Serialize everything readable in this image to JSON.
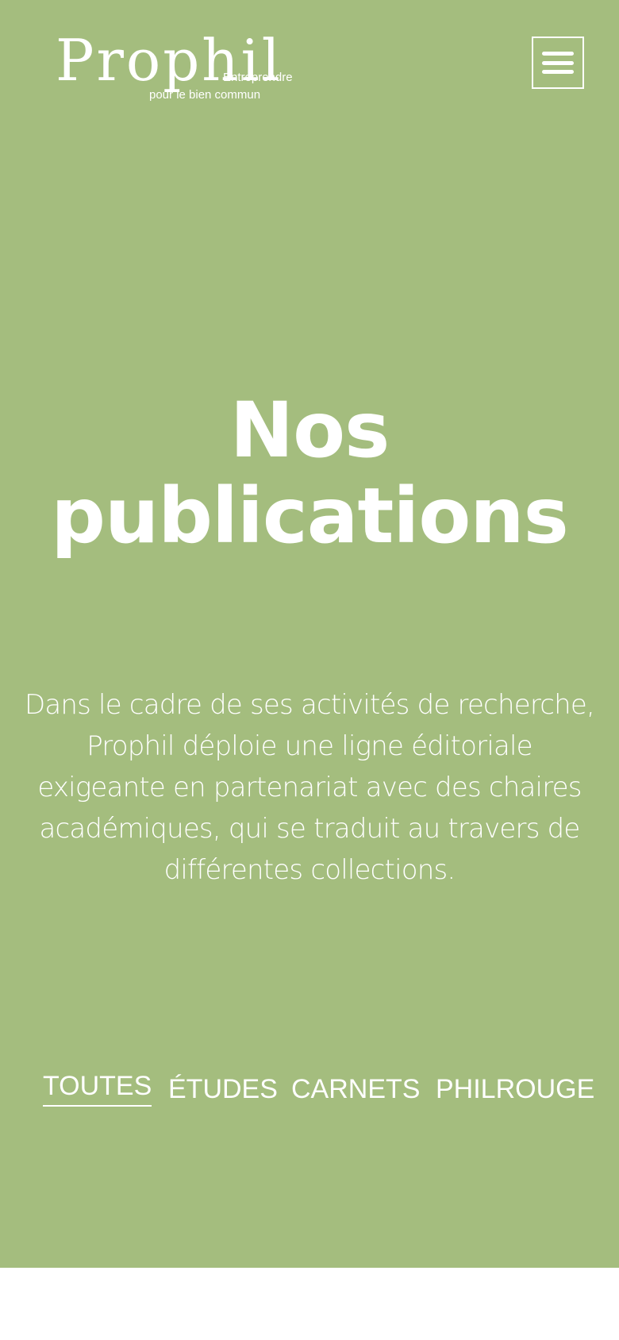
{
  "header": {
    "logo": {
      "word": "Prophil",
      "tagline_1": "Entreprendre",
      "tagline_2": "pour le bien commun"
    },
    "menu_icon": "hamburger-menu-icon"
  },
  "hero": {
    "background_color": "#a4bd7e",
    "title_line_1": "Nos",
    "title_line_2": "publications",
    "intro": "Dans le cadre de ses activités de recherche, Prophil déploie une ligne éditoriale exigeante en partenariat avec des chaires académiques, qui se traduit au travers de différentes collections."
  },
  "filters": {
    "active": "TOUTES",
    "tabs": [
      {
        "label": "TOUTES"
      },
      {
        "label": "ÉTUDES"
      },
      {
        "label": "CARNETS"
      },
      {
        "label": "PHILROUGE"
      }
    ]
  }
}
